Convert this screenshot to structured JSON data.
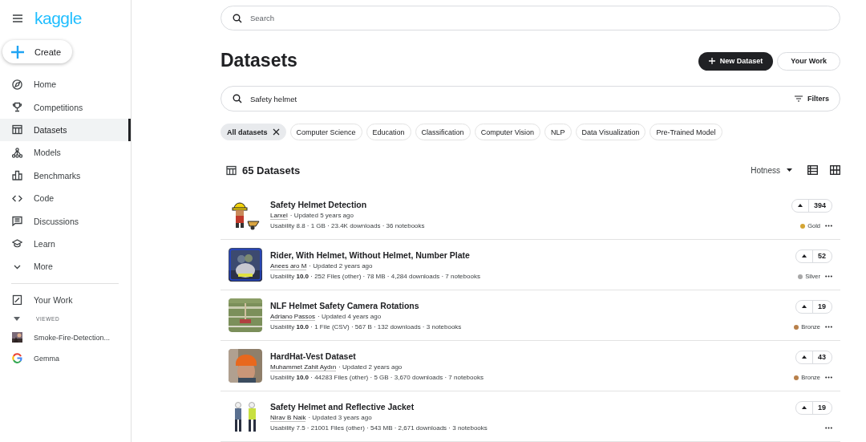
{
  "sidebar": {
    "logo": "kaggle",
    "create_button": "Create",
    "nav_items": [
      {
        "label": "Home",
        "selected": false
      },
      {
        "label": "Competitions",
        "selected": false
      },
      {
        "label": "Datasets",
        "selected": true
      },
      {
        "label": "Models",
        "selected": false
      },
      {
        "label": "Benchmarks",
        "selected": false
      },
      {
        "label": "Code",
        "selected": false
      },
      {
        "label": "Discussions",
        "selected": false
      },
      {
        "label": "Learn",
        "selected": false
      },
      {
        "label": "More",
        "selected": false
      }
    ],
    "your_work": "Your Work",
    "viewed_heading": "VIEWED",
    "viewed_items": [
      {
        "label": "Smoke-Fire-Detection...",
        "kind": "picture"
      },
      {
        "label": "Gemma",
        "kind": "logo"
      }
    ]
  },
  "top_search": {
    "placeholder": "Search"
  },
  "page_title": "Datasets",
  "buttons": [
    {
      "label": "New Dataset",
      "kind": "primary"
    },
    {
      "label": "Your Work",
      "kind": "secondary"
    }
  ],
  "dataset_search": {
    "value": "Safety helmet",
    "filters_button": "Filters"
  },
  "chips": [
    {
      "label": "All datasets",
      "selected": true
    },
    {
      "label": "Computer Science",
      "selected": false
    },
    {
      "label": "Education",
      "selected": false
    },
    {
      "label": "Classification",
      "selected": false
    },
    {
      "label": "Computer Vision",
      "selected": false
    },
    {
      "label": "NLP",
      "selected": false
    },
    {
      "label": "Data Visualization",
      "selected": false
    },
    {
      "label": "Pre-Trained Model",
      "selected": false
    }
  ],
  "results": {
    "count": "65 Datasets",
    "sort": "Hotness"
  },
  "datasets": [
    {
      "title": "Safety Helmet Detection",
      "author": "Larxel",
      "updated": "· Updated 5 years ago",
      "meta": "Usability 8.8 · 1 GB · 23.4K downloads · 36 notebooks",
      "votes": "394",
      "medal": "Gold",
      "color": "#d4a534"
    },
    {
      "title": "Rider, With Helmet, Without Helmet, Number Plate",
      "author": "Anees aro M",
      "updated": "· Updated 2 years ago",
      "meta": "Usability **10.0** · 252 Files (other) · 78 MB · 4,284 downloads · 7 notebooks",
      "votes": "52",
      "medal": "Silver",
      "color": "#a8a8a8"
    },
    {
      "title": "NLF Helmet Safety Camera Rotations",
      "author": "Adriano Passos",
      "updated": "· Updated 4 years ago",
      "meta": "Usability **10.0** · 1 File (CSV) · 567 B · 132 downloads · 3 notebooks",
      "votes": "19",
      "medal": "Bronze",
      "color": "#b8804a"
    },
    {
      "title": "HardHat-Vest Dataset",
      "author": "Muhammet Zahit Aydın",
      "updated": "· Updated 2 years ago",
      "meta": "Usability **10.0** · 44283 Files (other) · 5 GB · 3,670 downloads · 7 notebooks",
      "votes": "43",
      "medal": "Bronze",
      "color": "#b8804a"
    },
    {
      "title": "Safety Helmet and Reflective Jacket",
      "author": "Nirav B Naik",
      "updated": "· Updated 3 years ago",
      "meta": "Usability 7.5 · 21001 Files (other) · 543 MB · 2,671 downloads · 3 notebooks",
      "votes": "19"
    }
  ]
}
